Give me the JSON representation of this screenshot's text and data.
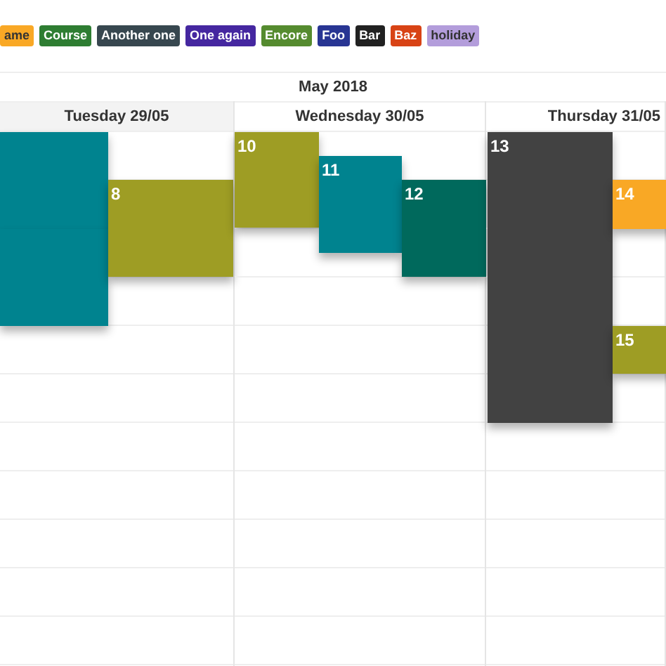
{
  "legend": [
    {
      "label": "ame",
      "color": "#f9a825"
    },
    {
      "label": "Course",
      "color": "#2e7d32"
    },
    {
      "label": "Another one",
      "color": "#37474f"
    },
    {
      "label": "One again",
      "color": "#4527a0"
    },
    {
      "label": "Encore",
      "color": "#558b2f"
    },
    {
      "label": "Foo",
      "color": "#283593"
    },
    {
      "label": "Bar",
      "color": "#212121"
    },
    {
      "label": "Baz",
      "color": "#d84315"
    },
    {
      "label": "holiday",
      "color": "#b39ddb"
    }
  ],
  "month": "May 2018",
  "days": [
    {
      "label": "Tuesday 29/05",
      "highlighted": true,
      "events": [
        {
          "color": "#00838f"
        },
        {
          "color": "#00838f"
        },
        {
          "label": "8",
          "color": "#9e9d24"
        }
      ]
    },
    {
      "label": "Wednesday 30/05",
      "highlighted": false,
      "events": [
        {
          "label": "10",
          "color": "#9e9d24"
        },
        {
          "label": "11",
          "color": "#00838f"
        },
        {
          "label": "12",
          "color": "#00695c"
        }
      ]
    },
    {
      "label": "Thursday 31/05",
      "highlighted": false,
      "events": [
        {
          "label": "13",
          "color": "#424242"
        },
        {
          "label": "14",
          "color": "#f9a825"
        },
        {
          "label": "15",
          "color": "#9e9d24"
        }
      ]
    }
  ]
}
